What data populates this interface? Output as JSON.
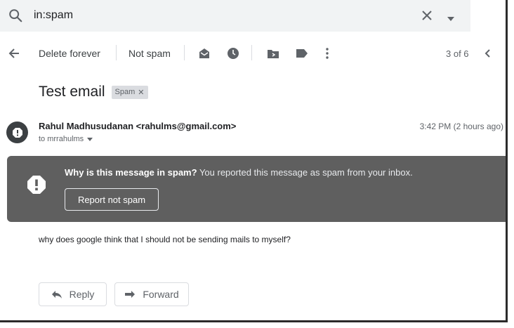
{
  "search": {
    "query": "in:spam"
  },
  "toolbar": {
    "delete_forever": "Delete forever",
    "not_spam": "Not spam",
    "pager": "3 of 6"
  },
  "email": {
    "subject": "Test email",
    "label_chip": "Spam",
    "sender": "Rahul Madhusudanan <rahulms@gmail.com>",
    "recipient": "to mrrahulms",
    "timestamp": "3:42 PM (2 hours ago)",
    "body": "why does google think that I should not be sending mails to myself?"
  },
  "spam_banner": {
    "question": "Why is this message in spam?",
    "explanation": "You reported this message as spam from your inbox.",
    "button": "Report not spam"
  },
  "actions": {
    "reply": "Reply",
    "forward": "Forward"
  },
  "icons": [
    "search-icon",
    "clear-search-icon",
    "search-options-icon",
    "back-arrow-icon",
    "mark-unread-icon",
    "snooze-icon",
    "move-to-icon",
    "labels-icon",
    "more-icon",
    "older-chevron-icon",
    "remove-label-icon",
    "sender-warning-icon",
    "show-details-icon",
    "spam-warning-icon",
    "reply-icon",
    "forward-icon"
  ],
  "colors": {
    "banner": "#5f5f5f",
    "search_bg": "#f1f3f4",
    "chip": "#dadce0"
  }
}
